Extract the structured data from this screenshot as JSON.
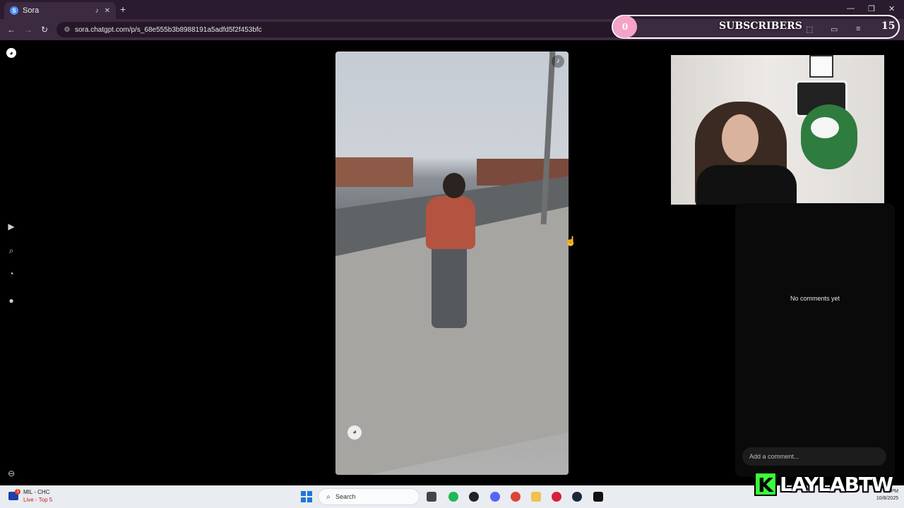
{
  "browser": {
    "tab_title": "Sora",
    "new_tab_icon": "plus-icon",
    "url": "sora.chatgpt.com/p/s_68e555b3b8988191a5adfd5f2f453bfc",
    "window_controls": [
      "minimize-icon",
      "restore-icon",
      "close-icon"
    ]
  },
  "overlay": {
    "subscribers_count": "0",
    "subscribers_label": "SUBSCRIBERS",
    "goal": "15",
    "brand_k": "K",
    "brand_name": "LAYLABTW"
  },
  "sora": {
    "rail_icons": [
      "sora-logo",
      "play-icon",
      "search-icon",
      "bell-icon",
      "avatar-icon",
      "more-icon"
    ],
    "comments_empty": "No comments yet",
    "comment_placeholder": "Add a comment..."
  },
  "taskbar": {
    "weather_badge": "1",
    "ticker_line1": "MIL - CHC",
    "ticker_line2": "Live - Top 5",
    "search_label": "Search",
    "time": "56 PM",
    "date": "10/8/2025"
  },
  "colors": {
    "tab_bar": "#2b1b2e",
    "address_bar": "#3c2a40",
    "brand_green": "#3dff38",
    "subs_pink": "#f4a3c7"
  }
}
